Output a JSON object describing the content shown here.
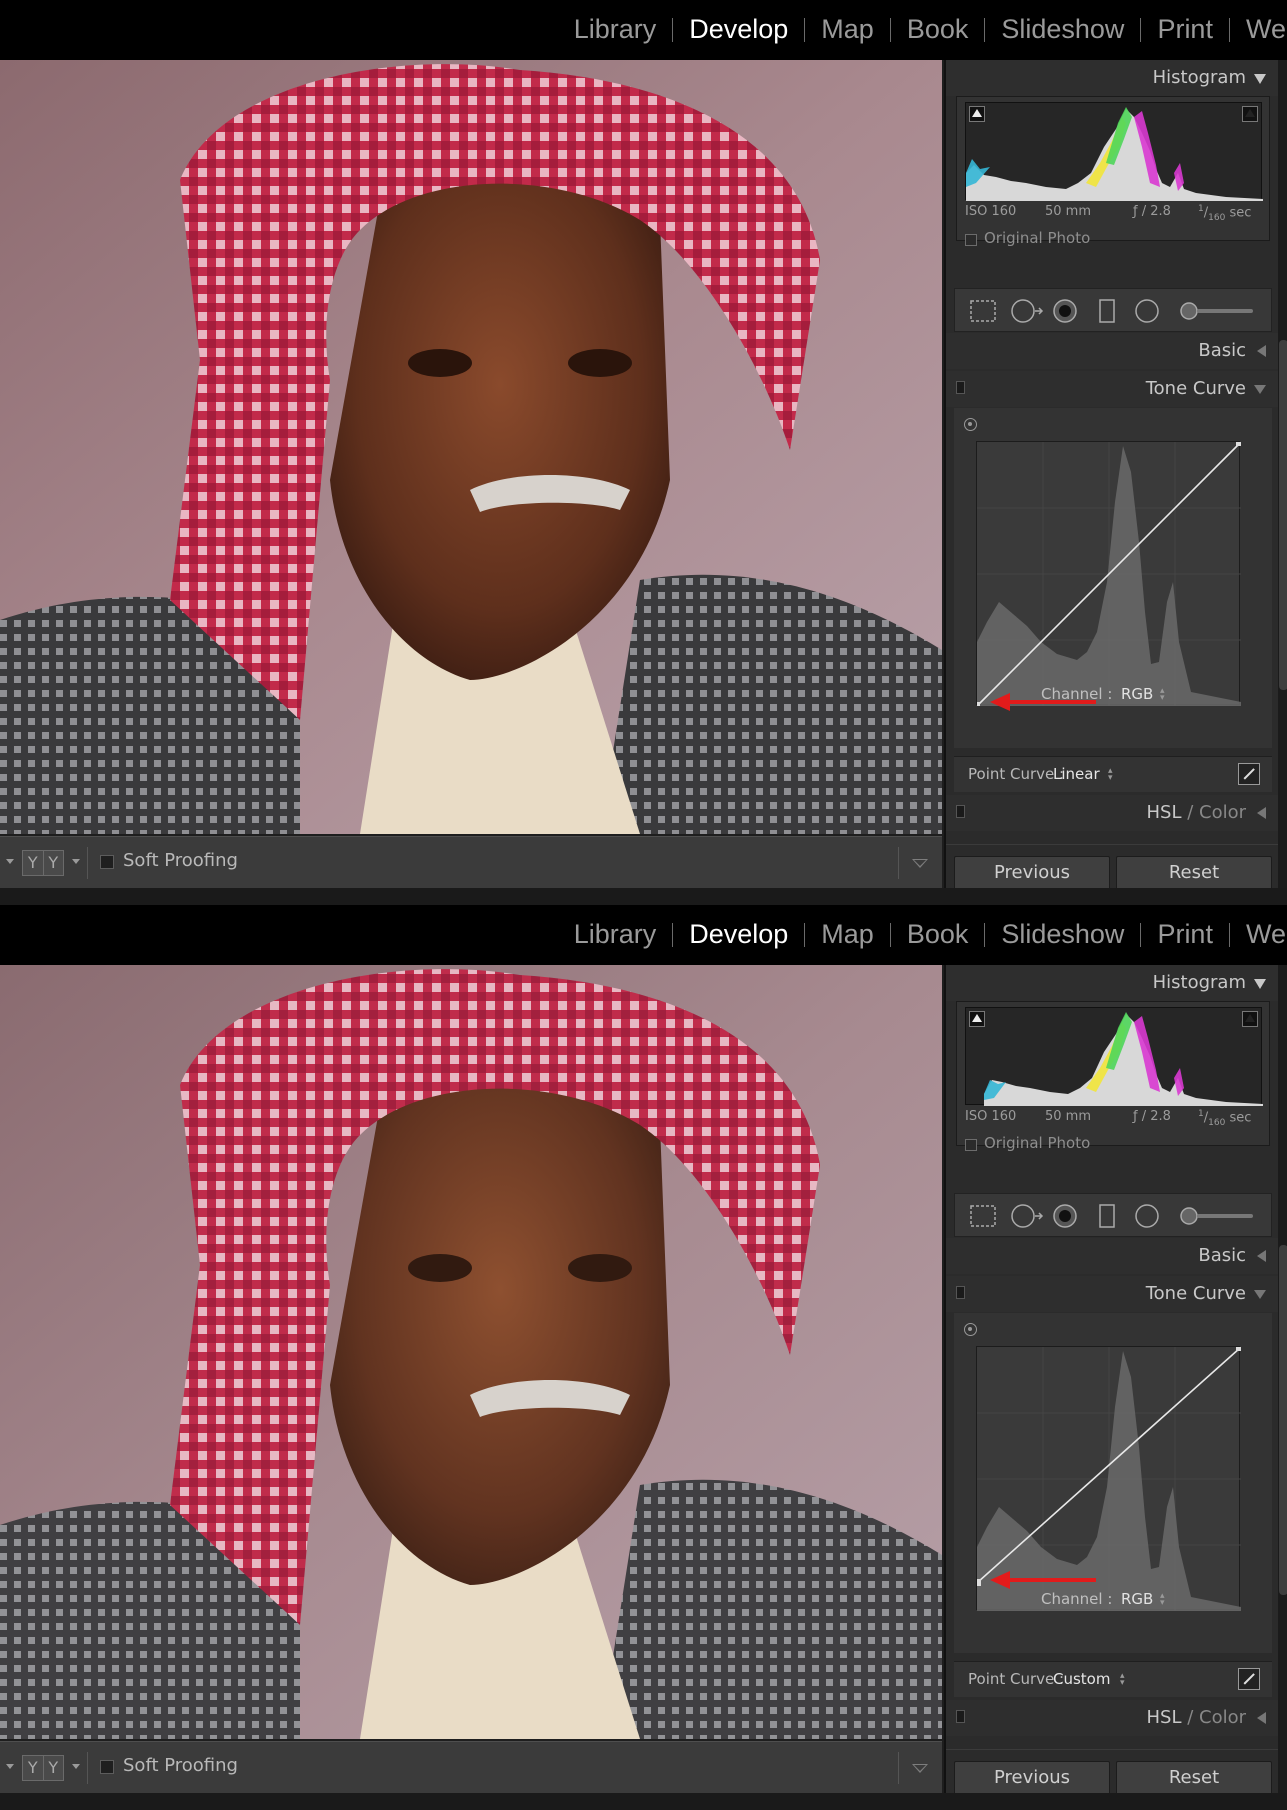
{
  "modules": [
    "Library",
    "Develop",
    "Map",
    "Book",
    "Slideshow",
    "Print",
    "Web"
  ],
  "active_module": "Develop",
  "toolbar": {
    "view_mode": [
      "Y",
      "Y"
    ],
    "soft_proofing_label": "Soft Proofing"
  },
  "panel": {
    "histogram_title": "Histogram",
    "exif": {
      "iso": "ISO 160",
      "focal": "50 mm",
      "aperture": "ƒ / 2.8",
      "shutter_num": "1",
      "shutter_den": "160",
      "shutter_unit": "sec"
    },
    "original_photo_label": "Original Photo",
    "basic_title": "Basic",
    "tone_curve_title": "Tone Curve",
    "channel_label": "Channel :",
    "channel_value": "RGB",
    "point_curve_label": "Point Curve :",
    "hsl_title_a": "HSL",
    "hsl_title_sep": " / ",
    "hsl_title_b": "Color",
    "previous_label": "Previous",
    "reset_label": "Reset"
  },
  "screens": [
    {
      "point_curve_value": "Linear",
      "curve_start": [
        0,
        0
      ],
      "curve_end": [
        255,
        255
      ],
      "arrow_color": "#e21b1b"
    },
    {
      "point_curve_value": "Custom",
      "curve_start": [
        0,
        28
      ],
      "curve_end": [
        255,
        255
      ],
      "arrow_color": "#e21b1b"
    }
  ],
  "colors": {
    "accent": "#ffffff",
    "panel_bg": "#2b2b2b",
    "arrow": "#e21b1b"
  }
}
